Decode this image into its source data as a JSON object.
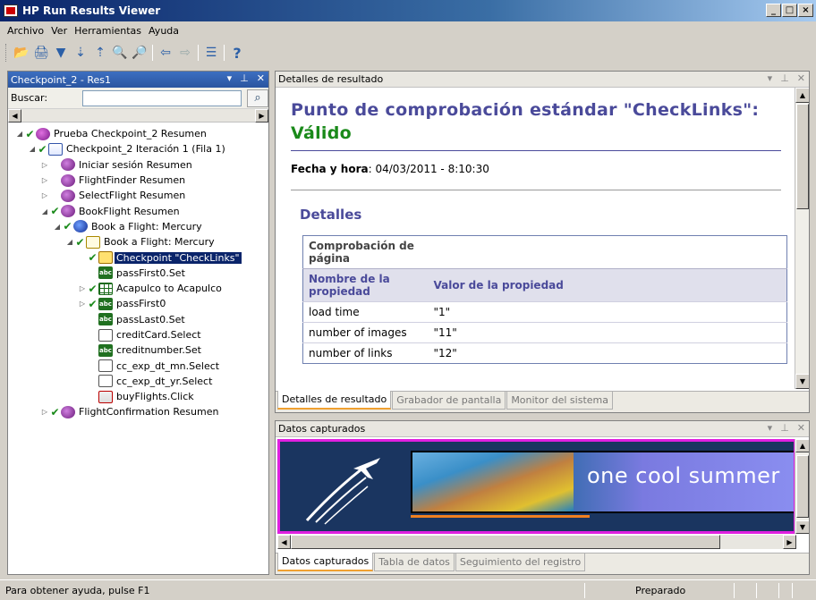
{
  "window": {
    "title": "HP Run Results Viewer",
    "controls": [
      "_",
      "□",
      "×"
    ]
  },
  "menu": [
    "Archivo",
    "Ver",
    "Herramientas",
    "Ayuda"
  ],
  "toolbar": {
    "icons": [
      "open-icon",
      "print-icon",
      "filter-icon",
      "expand-all-icon",
      "collapse-all-icon",
      "search-icon",
      "find-next-icon",
      "back-icon",
      "forward-icon",
      "list-icon",
      "help-icon"
    ],
    "glyphs": [
      "📂",
      "🖨",
      "▼",
      "⇣",
      "⇡",
      "🔍",
      "🔎",
      "⇦",
      "⇨",
      "☰",
      "?"
    ]
  },
  "left_panel": {
    "title": "Checkpoint_2 - Res1",
    "search_label": "Buscar:",
    "search_value": "",
    "tree": [
      {
        "level": 0,
        "expander": "◢",
        "check": "✔",
        "icon": "test",
        "label": "Prueba Checkpoint_2 Resumen"
      },
      {
        "level": 1,
        "expander": "◢",
        "check": "✔",
        "icon": "iter",
        "label": "Checkpoint_2 Iteración 1 (Fila 1)"
      },
      {
        "level": 2,
        "expander": "▷",
        "check": "",
        "icon": "action",
        "label": "Iniciar sesión Resumen"
      },
      {
        "level": 2,
        "expander": "▷",
        "check": "",
        "icon": "action",
        "label": "FlightFinder Resumen"
      },
      {
        "level": 2,
        "expander": "▷",
        "check": "",
        "icon": "action",
        "label": "SelectFlight Resumen"
      },
      {
        "level": 2,
        "expander": "◢",
        "check": "✔",
        "icon": "action",
        "label": "BookFlight Resumen"
      },
      {
        "level": 3,
        "expander": "◢",
        "check": "✔",
        "icon": "globe",
        "label": "Book a Flight: Mercury"
      },
      {
        "level": 4,
        "expander": "◢",
        "check": "✔",
        "icon": "page",
        "label": "Book a Flight: Mercury"
      },
      {
        "level": 5,
        "expander": "",
        "check": "✔",
        "icon": "cp",
        "label": "Checkpoint \"CheckLinks\"",
        "selected": true
      },
      {
        "level": 5,
        "expander": "",
        "check": "",
        "icon": "edit",
        "label": "passFirst0.Set"
      },
      {
        "level": 5,
        "expander": "▷",
        "check": "✔",
        "icon": "table",
        "label": "Acapulco to Acapulco"
      },
      {
        "level": 5,
        "expander": "▷",
        "check": "✔",
        "icon": "edit",
        "label": "passFirst0"
      },
      {
        "level": 5,
        "expander": "",
        "check": "",
        "icon": "edit",
        "label": "passLast0.Set"
      },
      {
        "level": 5,
        "expander": "",
        "check": "",
        "icon": "list",
        "label": "creditCard.Select"
      },
      {
        "level": 5,
        "expander": "",
        "check": "",
        "icon": "edit",
        "label": "creditnumber.Set"
      },
      {
        "level": 5,
        "expander": "",
        "check": "",
        "icon": "list",
        "label": "cc_exp_dt_mn.Select"
      },
      {
        "level": 5,
        "expander": "",
        "check": "",
        "icon": "list",
        "label": "cc_exp_dt_yr.Select"
      },
      {
        "level": 5,
        "expander": "",
        "check": "",
        "icon": "img",
        "label": "buyFlights.Click"
      },
      {
        "level": 2,
        "expander": "▷",
        "check": "✔",
        "icon": "action",
        "label": "FlightConfirmation Resumen"
      }
    ]
  },
  "result_details": {
    "pane_title": "Detalles de resultado",
    "heading": "Punto de comprobación estándar \"CheckLinks\":",
    "status": "Válido",
    "date_label": "Fecha y hora",
    "date_value": ": 04/03/2011 - 8:10:30",
    "section": "Detalles",
    "table": {
      "checkpoint_label": "Comprobación de página",
      "col1": "Nombre de la propiedad",
      "col2": "Valor de la propiedad",
      "rows": [
        [
          "load time",
          "\"1\""
        ],
        [
          "number of images",
          "\"11\""
        ],
        [
          "number of links",
          "\"12\""
        ]
      ]
    },
    "tabs": [
      "Detalles de resultado",
      "Grabador de pantalla",
      "Monitor del sistema"
    ]
  },
  "captured_data": {
    "pane_title": "Datos capturados",
    "banner_text": "one cool summer",
    "tabs": [
      "Datos capturados",
      "Tabla de datos",
      "Seguimiento del registro"
    ]
  },
  "pane_controls": [
    "▾",
    "⊥",
    "✕"
  ],
  "statusbar": {
    "help": "Para obtener ayuda, pulse F1",
    "state": "Preparado"
  }
}
